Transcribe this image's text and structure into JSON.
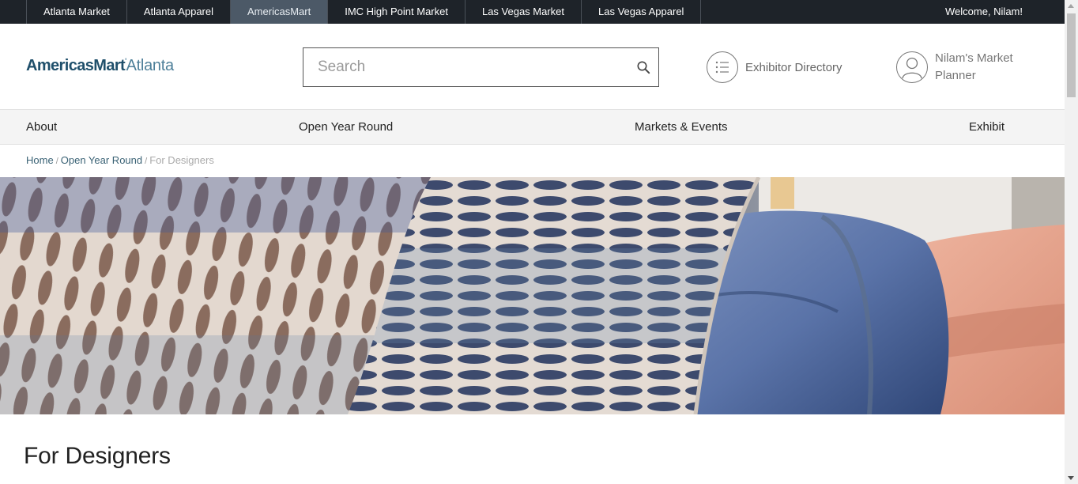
{
  "topbar": {
    "links": [
      {
        "label": "Atlanta Market",
        "active": false
      },
      {
        "label": "Atlanta Apparel",
        "active": false
      },
      {
        "label": "AmericasMart",
        "active": true
      },
      {
        "label": "IMC High Point Market",
        "active": false
      },
      {
        "label": "Las Vegas Market",
        "active": false
      },
      {
        "label": "Las Vegas Apparel",
        "active": false
      }
    ],
    "welcome": "Welcome, Nilam!"
  },
  "header": {
    "logo_part1": "AmericasMart",
    "logo_part2": "Atlanta",
    "search": {
      "placeholder": "Search",
      "value": ""
    },
    "exhibitor_directory": "Exhibitor Directory",
    "market_planner": "Nilam's Market Planner"
  },
  "mainnav": {
    "items": [
      "About",
      "Open Year Round",
      "Markets & Events",
      "Exhibit"
    ]
  },
  "breadcrumb": {
    "home": "Home",
    "level1": "Open Year Round",
    "separator": "/",
    "current": "For Designers"
  },
  "page": {
    "title": "For Designers"
  },
  "colors": {
    "topbar_bg": "#1e2329",
    "topbar_active": "#4c5967",
    "logo_dark": "#1f4f6b",
    "logo_light": "#4d7f99",
    "link": "#3a6275"
  },
  "icons": {
    "search": "search-icon",
    "directory": "list-icon",
    "planner": "user-icon"
  }
}
